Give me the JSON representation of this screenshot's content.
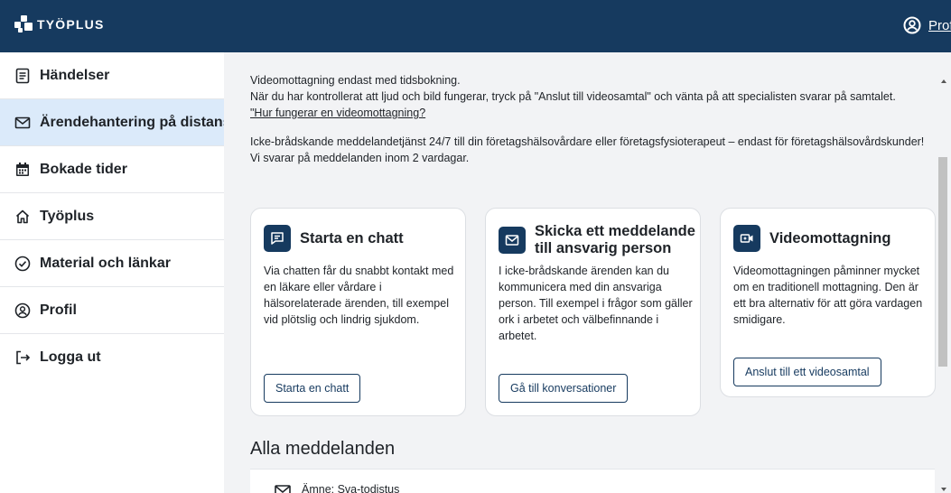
{
  "app": {
    "brand": "TYÖPLUS",
    "profile_link": "Profil"
  },
  "sidebar": {
    "items": [
      {
        "label": "Händelser",
        "icon": "document-icon"
      },
      {
        "label": "Ärendehantering på distans",
        "icon": "mail-icon",
        "active": true
      },
      {
        "label": "Bokade tider",
        "icon": "calendar-icon"
      },
      {
        "label": "Työplus",
        "icon": "home-icon"
      },
      {
        "label": "Material och länkar",
        "icon": "check-circle-icon"
      },
      {
        "label": "Profil",
        "icon": "user-icon"
      },
      {
        "label": "Logga ut",
        "icon": "logout-icon"
      }
    ]
  },
  "intro": {
    "line1": "Videomottagning endast med tidsbokning.",
    "line2": "När du har kontrollerat att ljud och bild fungerar, tryck på \"Anslut till videosamtal\" och vänta på att specialisten svarar på samtalet.",
    "link": "\"Hur fungerar en videomottagning?",
    "line3": "Icke-brådskande meddelandetjänst 24/7 till din företagshälsovårdare eller företagsfysioterapeut – endast för företagshälsovårdskunder! Vi svarar på meddelanden inom 2 vardagar."
  },
  "cards": [
    {
      "title": "Starta en chatt",
      "body": "Via chatten får du snabbt kontakt med en läkare eller vårdare i hälsorelaterade ärenden, till exempel vid plötslig och lindrig sjukdom.",
      "button": "Starta en chatt",
      "icon": "chat-icon"
    },
    {
      "title": "Skicka ett meddelande till ansvarig person",
      "body": "I icke-brådskande ärenden kan du kommunicera med din ansvariga person. Till exempel i frågor som gäller ork i arbetet och välbefinnande i arbetet.",
      "button": "Gå till konversationer",
      "icon": "mail-icon"
    },
    {
      "title": "Videomottagning",
      "body": "Videomottagningen påminner mycket om en traditionell mottagning. Den är ett bra alternativ för att göra vardagen smidigare.",
      "button": "Anslut till ett videosamtal",
      "icon": "video-icon"
    }
  ],
  "messages": {
    "heading": "Alla meddelanden",
    "items": [
      {
        "subject": "Ämne: Sva-todistus"
      }
    ]
  },
  "colors": {
    "brand_navy": "#163a5f",
    "active_bg": "#dbeafa"
  }
}
